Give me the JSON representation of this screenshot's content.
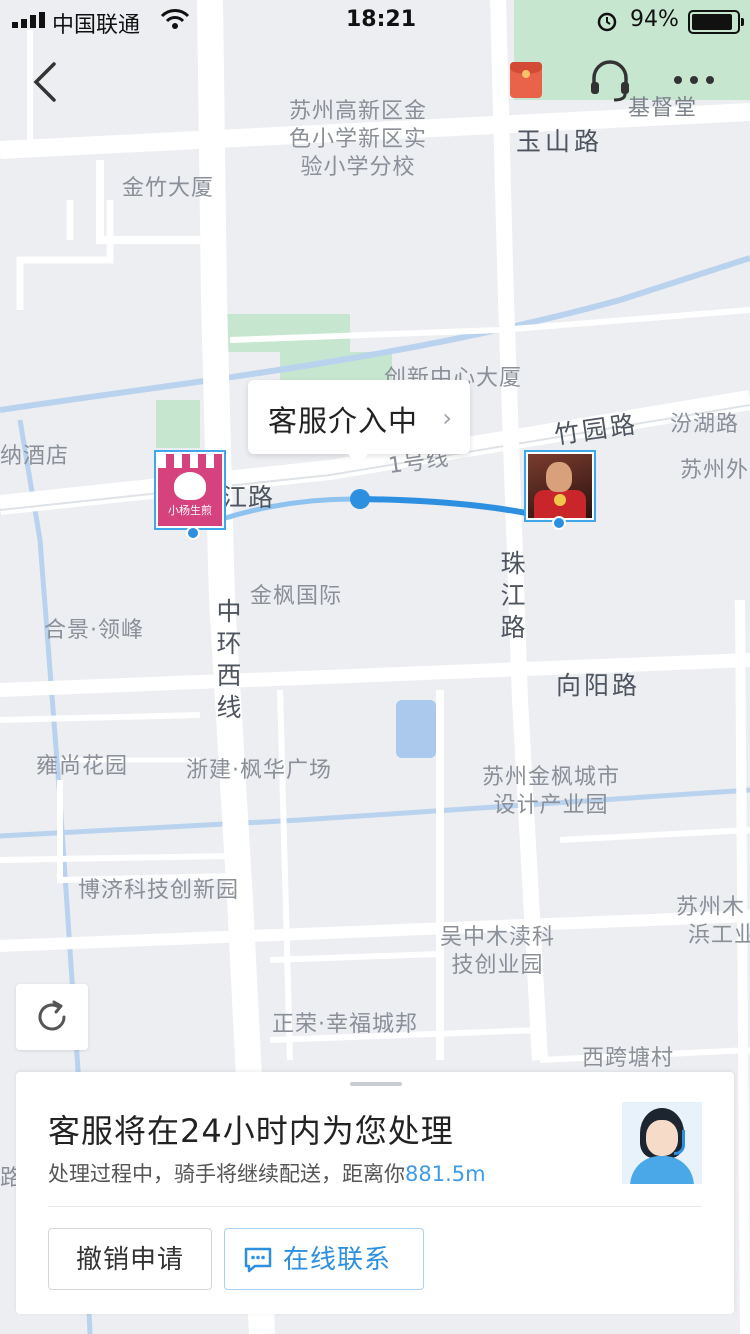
{
  "status_bar": {
    "carrier": "中国联通",
    "time": "18:21",
    "battery": "94%",
    "battery_level": 0.94
  },
  "map": {
    "labels": {
      "school": [
        "苏州高新区金",
        "色小学新区实",
        "验小学分校"
      ],
      "jinzhu": "金竹大厦",
      "yushan_road": "玉山路",
      "jidutang": "基督堂",
      "chuangxin": "创新中心大厦",
      "zhuyuan_road": "竹园路",
      "fenhu_road": "汾湖路",
      "suzhou_wai": "苏州外",
      "hotel": "纳酒店",
      "line1": "1号线",
      "road_partial": "江路",
      "jinfeng_intl": "金枫国际",
      "hejing": "合景·领峰",
      "zhujiang_road": "珠江路",
      "zhonghuan_west": "中环西线",
      "xiangyang_road": "向阳路",
      "yongshang": "雍尚花园",
      "zhejian": "浙建·枫华广场",
      "jinfeng_park": [
        "苏州金枫城市",
        "设计产业园"
      ],
      "boji": "博济科技创新园",
      "suzhou_mu": [
        "苏州木",
        "浜工业"
      ],
      "wuzhong": [
        "吴中木渎科",
        "技创业园"
      ],
      "zhengrong": "正荣·幸福城邦",
      "xikua": "西跨塘村",
      "edge_road": "路"
    },
    "shop_marker": {
      "name": "小杨生煎"
    },
    "popup": {
      "text": "客服介入中",
      "chevron": "›"
    }
  },
  "icons": {
    "back": "back-chevron-icon",
    "red_packet": "red-packet-icon",
    "customer_service": "headset-icon",
    "more": "more-dots-icon",
    "refresh": "refresh-icon",
    "chat": "chat-bubble-icon"
  },
  "panel": {
    "title": "客服将在24小时内为您处理",
    "subtitle_prefix": "处理过程中，骑手将继续配送，距离你",
    "distance": "881.5m",
    "cancel_label": "撤销申请",
    "chat_label": "在线联系"
  },
  "colors": {
    "accent": "#2d8fe0",
    "route": "#4aa3ea",
    "shop_pink": "#d6427e",
    "green_area": "#c7e6cf"
  }
}
